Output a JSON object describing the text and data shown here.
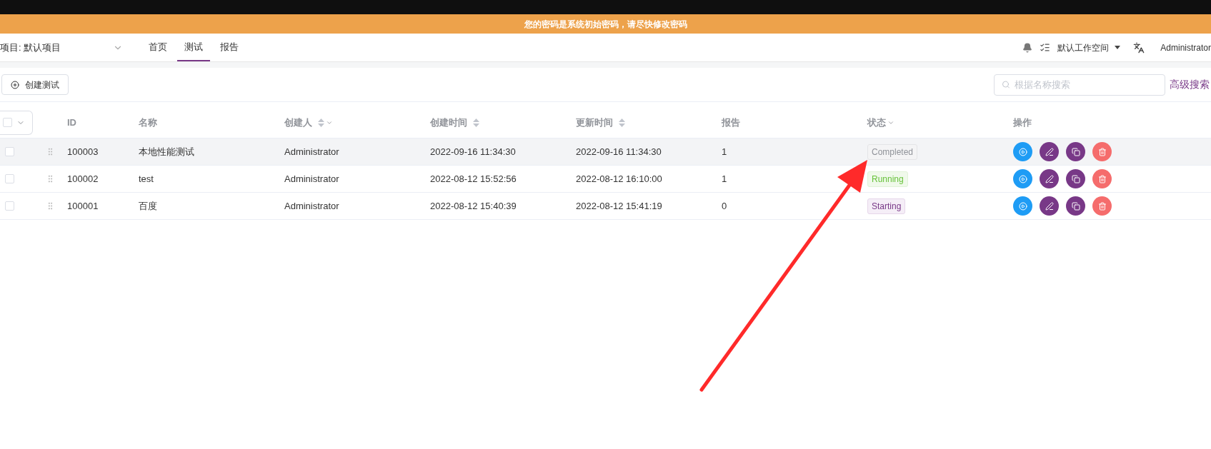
{
  "banner": {
    "text": "您的密码是系统初始密码，请尽快修改密码"
  },
  "nav": {
    "project": "项目: 默认项目",
    "tabs": [
      {
        "label": "首页",
        "selected": false
      },
      {
        "label": "测试",
        "selected": true
      },
      {
        "label": "报告",
        "selected": false
      }
    ],
    "workspace": "默认工作空间",
    "user": "Administrator"
  },
  "toolbar": {
    "create_button": "创建测试",
    "search": {
      "placeholder": "根据名称搜索"
    },
    "advanced_search": "高级搜索"
  },
  "table": {
    "columns": [
      {
        "label": "ID",
        "sortable": false,
        "filter": false
      },
      {
        "label": "名称",
        "sortable": false,
        "filter": false
      },
      {
        "label": "创建人",
        "sortable": true,
        "filter": true
      },
      {
        "label": "创建时间",
        "sortable": true,
        "filter": false
      },
      {
        "label": "更新时间",
        "sortable": true,
        "filter": false
      },
      {
        "label": "报告",
        "sortable": false,
        "filter": false
      },
      {
        "label": "状态",
        "sortable": false,
        "filter": true
      },
      {
        "label": "操作",
        "sortable": false,
        "filter": false
      }
    ],
    "all_selected": false,
    "rows": [
      {
        "id": "100003",
        "name": "本地性能测试",
        "creator": "Administrator",
        "created": "2022-09-16 11:34:30",
        "updated": "2022-09-16 11:34:30",
        "reports": "1",
        "status": {
          "text": "Completed",
          "kind": "completed"
        },
        "selected": false,
        "hovered": true
      },
      {
        "id": "100002",
        "name": "test",
        "creator": "Administrator",
        "created": "2022-08-12 15:52:56",
        "updated": "2022-08-12 16:10:00",
        "reports": "1",
        "status": {
          "text": "Running",
          "kind": "running"
        },
        "selected": false,
        "hovered": false
      },
      {
        "id": "100001",
        "name": "百度",
        "creator": "Administrator",
        "created": "2022-08-12 15:40:39",
        "updated": "2022-08-12 15:41:19",
        "reports": "0",
        "status": {
          "text": "Starting",
          "kind": "starting"
        },
        "selected": false,
        "hovered": false
      }
    ]
  }
}
